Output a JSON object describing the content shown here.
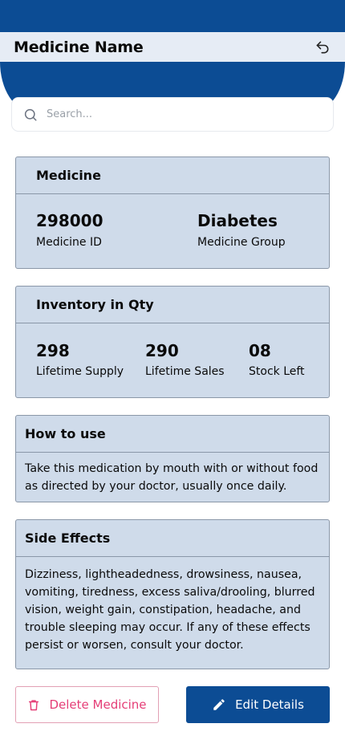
{
  "header": {
    "title": "Medicine Name",
    "undo_icon": "undo-icon"
  },
  "search": {
    "placeholder": "Search...",
    "value": "",
    "icon": "search-icon"
  },
  "medicine_card": {
    "title": "Medicine",
    "id_value": "298000",
    "id_label": "Medicine ID",
    "group_value": "Diabetes",
    "group_label": "Medicine Group"
  },
  "inventory_card": {
    "title": "Inventory in Qty",
    "stats": [
      {
        "value": "298",
        "label": "Lifetime Supply"
      },
      {
        "value": "290",
        "label": "Lifetime Sales"
      },
      {
        "value": "08",
        "label": "Stock Left"
      }
    ]
  },
  "how_to_use": {
    "title": "How to use",
    "text": "Take this medication by mouth with or without food as directed by your doctor, usually once daily."
  },
  "side_effects": {
    "title": "Side Effects",
    "text": "Dizziness, lightheadedness, drowsiness, nausea, vomiting, tiredness, excess saliva/drooling, blurred vision, weight gain, constipation, headache, and trouble sleeping may occur. If any of these effects persist or worsen, consult your doctor."
  },
  "actions": {
    "delete_label": "Delete Medicine",
    "delete_icon": "trash-icon",
    "edit_label": "Edit Details",
    "edit_icon": "pencil-icon"
  },
  "colors": {
    "primary": "#0c4c94",
    "card_bg": "#cfdbea",
    "header_bg": "#e6ecf5",
    "danger": "#e53e77"
  }
}
